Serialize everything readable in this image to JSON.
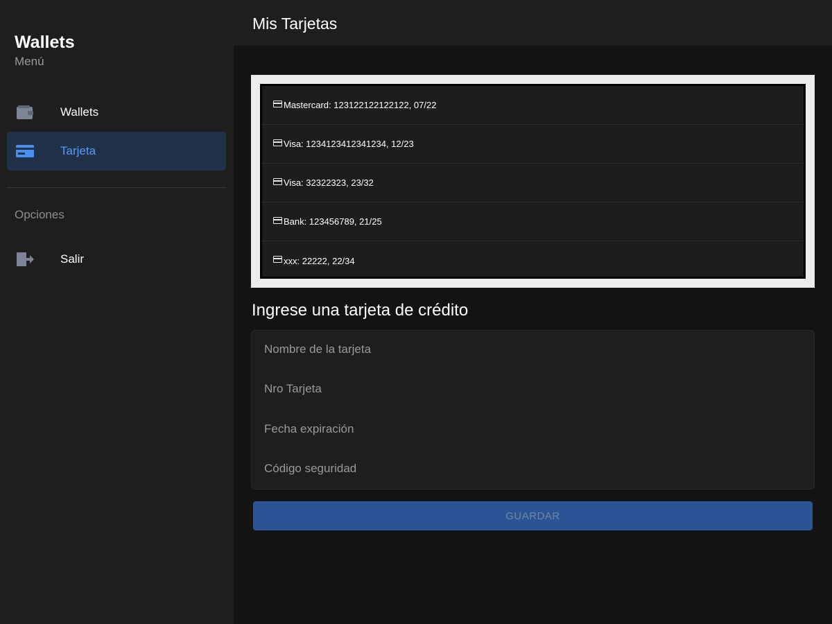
{
  "sidebar": {
    "title": "Wallets",
    "subtitle": "Menú",
    "items": [
      {
        "label": "Wallets",
        "icon": "wallet-icon",
        "active": false
      },
      {
        "label": "Tarjeta",
        "icon": "credit-card-icon",
        "active": true
      }
    ],
    "section_label": "Opciones",
    "options": [
      {
        "label": "Salir",
        "icon": "logout-icon"
      }
    ],
    "colors": {
      "active_bg": "#22314a",
      "active_text": "#5b9cf2"
    }
  },
  "header": {
    "title": "Mis Tarjetas"
  },
  "cards": [
    "Mastercard: 123122122122122, 07/22",
    "Visa: 1234123412341234, 12/23",
    "Visa: 32322323, 23/32",
    "Bank: 123456789, 21/25",
    "xxx: 22222, 22/34"
  ],
  "form": {
    "title": "Ingrese una tarjeta de crédito",
    "fields": {
      "name_placeholder": "Nombre de la tarjeta",
      "number_placeholder": "Nro Tarjeta",
      "expiry_placeholder": "Fecha expiración",
      "cvv_placeholder": "Código seguridad"
    },
    "save_label": "GUARDAR"
  }
}
